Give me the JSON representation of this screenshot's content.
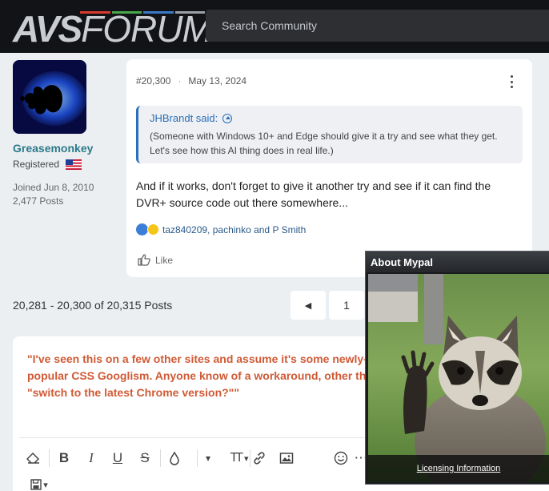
{
  "header": {
    "logo": {
      "avs": "AVS",
      "forum": "FORUM"
    },
    "logo_bar_colors": [
      "#d83a2e",
      "#46a84a",
      "#3a78c8",
      "#9aa0a8"
    ],
    "search_placeholder": "Search Community"
  },
  "post": {
    "author": {
      "name": "Greasemonkey",
      "role": "Registered",
      "joined": "Joined Jun 8, 2010",
      "posts": "2,477 Posts"
    },
    "number": "#20,300",
    "date": "May 13, 2024",
    "quote": {
      "author": "JHBrandt said:",
      "text": "(Someone with Windows 10+ and Edge should give it a try and see what they get. Let's see how this AI thing does in real life.)"
    },
    "body": "And if it works, don't forget to give it another try and see if it can find the DVR+ source code out there somewhere...",
    "reactions": "taz840209, pachinko and P Smith",
    "like_label": "Like"
  },
  "pagination": {
    "summary": "20,281 - 20,300 of 20,315 Posts",
    "prev_icon": "◀",
    "page": "1"
  },
  "editor": {
    "text": "\"I've seen this on a few other sites and assume it's some newly-popular CSS Googlism. Anyone know of a workaround, other than \"switch to the latest Chrome version?\"\"",
    "toolbar": {
      "bold": "B",
      "italic": "I",
      "underline": "U",
      "strike": "S",
      "text_size": "TT",
      "more": "⋯"
    }
  },
  "popup": {
    "title": "About Mypal",
    "link": "Licensing Information"
  },
  "colors": {
    "accent": "#2a7a8a",
    "link": "#2a6fb8",
    "editor_text": "#d05a35"
  }
}
